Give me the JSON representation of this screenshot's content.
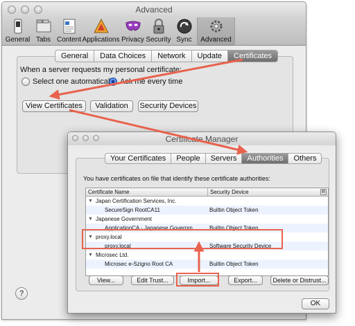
{
  "advanced_window": {
    "title": "Advanced",
    "toolbar": [
      {
        "label": "General",
        "icon": "switch-icon"
      },
      {
        "label": "Tabs",
        "icon": "tabs-icon"
      },
      {
        "label": "Content",
        "icon": "content-icon"
      },
      {
        "label": "Applications",
        "icon": "applications-icon"
      },
      {
        "label": "Privacy",
        "icon": "privacy-mask-icon"
      },
      {
        "label": "Security",
        "icon": "lock-icon"
      },
      {
        "label": "Sync",
        "icon": "sync-icon"
      },
      {
        "label": "Advanced",
        "icon": "gear-icon",
        "selected": true
      }
    ],
    "tabs": [
      {
        "label": "General"
      },
      {
        "label": "Data Choices"
      },
      {
        "label": "Network"
      },
      {
        "label": "Update"
      },
      {
        "label": "Certificates",
        "selected": true
      }
    ],
    "prompt": "When a server requests my personal certificate:",
    "radio_options": [
      {
        "label": "Select one automatically",
        "checked": false
      },
      {
        "label": "Ask me every time",
        "checked": true
      }
    ],
    "buttons": {
      "view_certificates": "View Certificates",
      "validation": "Validation",
      "security_devices": "Security Devices"
    },
    "help": "?"
  },
  "certificate_manager": {
    "title": "Certificate Manager",
    "tabs": [
      {
        "label": "Your Certificates"
      },
      {
        "label": "People"
      },
      {
        "label": "Servers"
      },
      {
        "label": "Authorities",
        "selected": true
      },
      {
        "label": "Others"
      }
    ],
    "intro": "You have certificates on file that identify these certificate authorities:",
    "columns": {
      "name": "Certificate Name",
      "device": "Security Device"
    },
    "rows": [
      {
        "type": "group",
        "name": "Japan Certification Services, Inc.",
        "device": ""
      },
      {
        "type": "cert",
        "name": "SecureSign RootCA11",
        "device": "Builtin Object Token"
      },
      {
        "type": "group",
        "name": "Japanese Government",
        "device": ""
      },
      {
        "type": "cert",
        "name": "ApplicationCA - Japanese Governm...",
        "device": "Builtin Object Token"
      },
      {
        "type": "group",
        "name": "proxy.local",
        "device": ""
      },
      {
        "type": "cert",
        "name": "proxy.local",
        "device": "Software Security Device"
      },
      {
        "type": "group",
        "name": "Microsec Ltd.",
        "device": ""
      },
      {
        "type": "cert",
        "name": "Microsec e-Szigno Root CA",
        "device": "Builtin Object Token"
      }
    ],
    "buttons": {
      "view": "View...",
      "edit_trust": "Edit Trust...",
      "import": "Import...",
      "export": "Export...",
      "delete": "Delete or Distrust...",
      "ok": "OK"
    }
  },
  "annotation_color": "#e8624d"
}
